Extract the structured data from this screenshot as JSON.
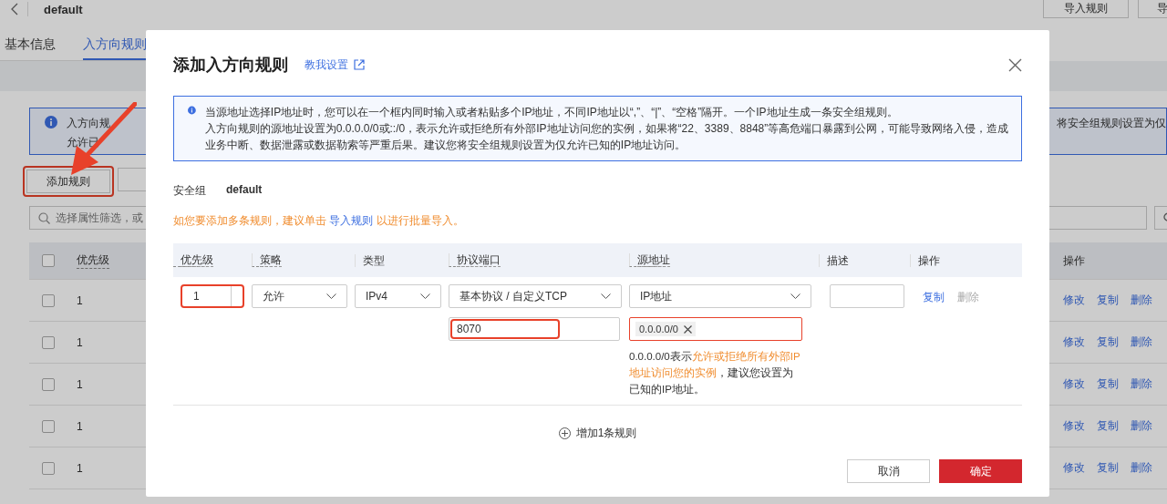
{
  "page": {
    "title": "default",
    "header_buttons": [
      "导入规则",
      "导"
    ],
    "tabs": [
      {
        "label": "基本信息",
        "selected": false
      },
      {
        "label": "入方向规则",
        "selected": true
      }
    ],
    "notice": {
      "line_1": "入方向规",
      "line_1_end": "将安全组规则设置为仅",
      "line_2": "允许已"
    },
    "add_button": {
      "label": "添加规则",
      "annotated": true
    },
    "search": {
      "placeholder": "选择属性筛选，或"
    },
    "table": {
      "select_all": {
        "checked": false
      },
      "columns": [
        "优先级",
        "操作"
      ],
      "rows": [
        {
          "checked": false,
          "priority": "1",
          "actions": [
            "修改",
            "复制",
            "删除"
          ]
        },
        {
          "checked": false,
          "priority": "1",
          "actions": [
            "修改",
            "复制",
            "删除"
          ]
        },
        {
          "checked": false,
          "priority": "1",
          "actions": [
            "修改",
            "复制",
            "删除"
          ]
        },
        {
          "checked": false,
          "priority": "1",
          "actions": [
            "修改",
            "复制",
            "删除"
          ]
        },
        {
          "checked": false,
          "priority": "1",
          "actions": [
            "修改",
            "复制",
            "删除"
          ]
        }
      ]
    }
  },
  "dialog": {
    "title": "添加入方向规则",
    "help_link": "教我设置",
    "notice": [
      "当源地址选择IP地址时，您可以在一个框内同时输入或者粘贴多个IP地址，不同IP地址以“,”、“|”、“空格”隔开。一个IP地址生成一条安全组规则。",
      "入方向规则的源地址设置为0.0.0.0/0或::/0，表示允许或拒绝所有外部IP地址访问您的实例，如果将“22、3389、8848”等高危端口暴露到公网，可能导致网络入侵，造成业务中断、数据泄露或数据勒索等严重后果。建议您将安全组规则设置为仅允许已知的IP地址访问。"
    ],
    "security_group": {
      "label": "安全组",
      "value": "default"
    },
    "bulk_hint": {
      "before": "如您要添加多条规则，建议单击 ",
      "link": "导入规则",
      "after": " 以进行批量导入。"
    },
    "columns": [
      {
        "label": "优先级",
        "dashed": true
      },
      {
        "label": "策略",
        "dashed": true
      },
      {
        "label": "类型",
        "dashed": false
      },
      {
        "label": "协议端口",
        "dashed": true
      },
      {
        "label": "源地址",
        "dashed": true
      },
      {
        "label": "描述",
        "dashed": false
      },
      {
        "label": "操作",
        "dashed": false
      }
    ],
    "rule": {
      "priority": {
        "value": "1",
        "annotated": true
      },
      "policy": "允许",
      "type": "IPv4",
      "protocol": "基本协议 / 自定义TCP",
      "port": {
        "value": "8070",
        "annotated": true
      },
      "source_type": "IP地址",
      "source": {
        "tag": "0.0.0.0/0",
        "annotated": true
      },
      "source_hint": [
        {
          "text": "0.0.0.0/0表示",
          "highlight": false
        },
        {
          "text": "允许或拒绝所有外部IP地址访问您的实例",
          "highlight": true
        },
        {
          "text": "，建议您设置为已知的IP地址。",
          "highlight": false
        }
      ],
      "actions": [
        {
          "label": "复制",
          "disabled": false
        },
        {
          "label": "删除",
          "disabled": true
        }
      ]
    },
    "add_row": "增加1条规则",
    "buttons": [
      {
        "label": "取消",
        "kind": "secondary"
      },
      {
        "label": "确定",
        "kind": "primary"
      }
    ]
  }
}
